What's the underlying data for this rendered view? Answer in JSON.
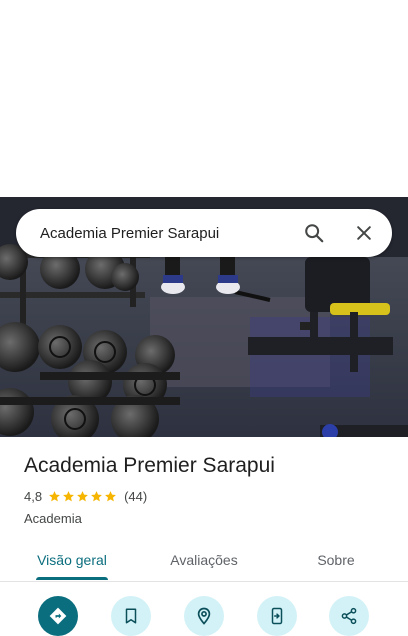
{
  "search": {
    "query": "Academia Premier Sarapui"
  },
  "place": {
    "name": "Academia Premier Sarapui",
    "rating": "4,8",
    "stars": 5,
    "reviews": "(44)",
    "category": "Academia"
  },
  "tabs": [
    {
      "label": "Visão geral",
      "active": true
    },
    {
      "label": "Avaliações",
      "active": false
    },
    {
      "label": "Sobre",
      "active": false
    }
  ],
  "actions": [
    {
      "icon": "directions-icon"
    },
    {
      "icon": "bookmark-icon"
    },
    {
      "icon": "nearby-icon"
    },
    {
      "icon": "send-to-phone-icon"
    },
    {
      "icon": "share-icon"
    }
  ],
  "colors": {
    "accent": "#0b6e7e",
    "action_bg": "#d3f2f7",
    "star": "#f6b500"
  }
}
